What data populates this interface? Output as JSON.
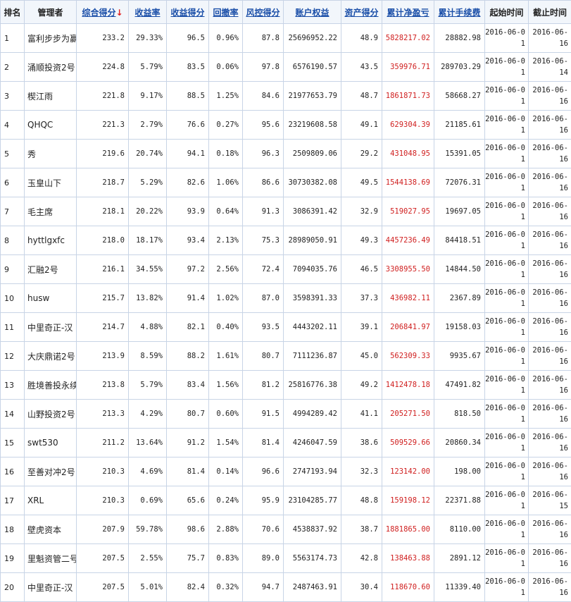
{
  "headers": {
    "rank": "排名",
    "manager": "管理者",
    "score": "综合得分",
    "sort_arrow": "↓",
    "return_rate": "收益率",
    "return_score": "收益得分",
    "drawdown": "回撤率",
    "risk_score": "风控得分",
    "equity": "账户权益",
    "asset_score": "资产得分",
    "cum_pnl": "累计净盈亏",
    "cum_fee": "累计手续费",
    "start_time": "起始时间",
    "end_time": "截止时间"
  },
  "colors": {
    "link": "#1a4ea8",
    "profit": "#d02020",
    "border": "#c8d4e6",
    "arrow": "#e02020"
  },
  "rows": [
    {
      "rank": "1",
      "manager": "富利步步为赢",
      "score": "233.2",
      "return_rate": "29.33%",
      "return_score": "96.5",
      "drawdown": "0.96%",
      "risk_score": "87.8",
      "equity": "25696952.22",
      "asset_score": "48.9",
      "cum_pnl": "5828217.02",
      "cum_fee": "28882.98",
      "start": "2016-06-01",
      "end": "2016-06-16"
    },
    {
      "rank": "2",
      "manager": "涌顺投资2号",
      "score": "224.8",
      "return_rate": "5.79%",
      "return_score": "83.5",
      "drawdown": "0.06%",
      "risk_score": "97.8",
      "equity": "6576190.57",
      "asset_score": "43.5",
      "cum_pnl": "359976.71",
      "cum_fee": "289703.29",
      "start": "2016-06-01",
      "end": "2016-06-14"
    },
    {
      "rank": "3",
      "manager": "楔江雨",
      "score": "221.8",
      "return_rate": "9.17%",
      "return_score": "88.5",
      "drawdown": "1.25%",
      "risk_score": "84.6",
      "equity": "21977653.79",
      "asset_score": "48.7",
      "cum_pnl": "1861871.73",
      "cum_fee": "58668.27",
      "start": "2016-06-01",
      "end": "2016-06-16"
    },
    {
      "rank": "4",
      "manager": "QHQC",
      "score": "221.3",
      "return_rate": "2.79%",
      "return_score": "76.6",
      "drawdown": "0.27%",
      "risk_score": "95.6",
      "equity": "23219608.58",
      "asset_score": "49.1",
      "cum_pnl": "629304.39",
      "cum_fee": "21185.61",
      "start": "2016-06-01",
      "end": "2016-06-16"
    },
    {
      "rank": "5",
      "manager": "秀",
      "score": "219.6",
      "return_rate": "20.74%",
      "return_score": "94.1",
      "drawdown": "0.18%",
      "risk_score": "96.3",
      "equity": "2509809.06",
      "asset_score": "29.2",
      "cum_pnl": "431048.95",
      "cum_fee": "15391.05",
      "start": "2016-06-01",
      "end": "2016-06-16"
    },
    {
      "rank": "6",
      "manager": "玉皇山下",
      "score": "218.7",
      "return_rate": "5.29%",
      "return_score": "82.6",
      "drawdown": "1.06%",
      "risk_score": "86.6",
      "equity": "30730382.08",
      "asset_score": "49.5",
      "cum_pnl": "1544138.69",
      "cum_fee": "72076.31",
      "start": "2016-06-01",
      "end": "2016-06-16"
    },
    {
      "rank": "7",
      "manager": "毛主席",
      "score": "218.1",
      "return_rate": "20.22%",
      "return_score": "93.9",
      "drawdown": "0.64%",
      "risk_score": "91.3",
      "equity": "3086391.42",
      "asset_score": "32.9",
      "cum_pnl": "519027.95",
      "cum_fee": "19697.05",
      "start": "2016-06-01",
      "end": "2016-06-16"
    },
    {
      "rank": "8",
      "manager": "hyttlgxfc",
      "score": "218.0",
      "return_rate": "18.17%",
      "return_score": "93.4",
      "drawdown": "2.13%",
      "risk_score": "75.3",
      "equity": "28989050.91",
      "asset_score": "49.3",
      "cum_pnl": "4457236.49",
      "cum_fee": "84418.51",
      "start": "2016-06-01",
      "end": "2016-06-16"
    },
    {
      "rank": "9",
      "manager": "汇融2号",
      "score": "216.1",
      "return_rate": "34.55%",
      "return_score": "97.2",
      "drawdown": "2.56%",
      "risk_score": "72.4",
      "equity": "7094035.76",
      "asset_score": "46.5",
      "cum_pnl": "3308955.50",
      "cum_fee": "14844.50",
      "start": "2016-06-01",
      "end": "2016-06-16"
    },
    {
      "rank": "10",
      "manager": "husw",
      "score": "215.7",
      "return_rate": "13.82%",
      "return_score": "91.4",
      "drawdown": "1.02%",
      "risk_score": "87.0",
      "equity": "3598391.33",
      "asset_score": "37.3",
      "cum_pnl": "436982.11",
      "cum_fee": "2367.89",
      "start": "2016-06-01",
      "end": "2016-06-16"
    },
    {
      "rank": "11",
      "manager": "中里奇正-汉",
      "score": "214.7",
      "return_rate": "4.88%",
      "return_score": "82.1",
      "drawdown": "0.40%",
      "risk_score": "93.5",
      "equity": "4443202.11",
      "asset_score": "39.1",
      "cum_pnl": "206841.97",
      "cum_fee": "19158.03",
      "start": "2016-06-01",
      "end": "2016-06-16"
    },
    {
      "rank": "12",
      "manager": "大庆鼎诺2号",
      "score": "213.9",
      "return_rate": "8.59%",
      "return_score": "88.2",
      "drawdown": "1.61%",
      "risk_score": "80.7",
      "equity": "7111236.87",
      "asset_score": "45.0",
      "cum_pnl": "562309.33",
      "cum_fee": "9935.67",
      "start": "2016-06-01",
      "end": "2016-06-16"
    },
    {
      "rank": "13",
      "manager": "胜境善投永续",
      "score": "213.8",
      "return_rate": "5.79%",
      "return_score": "83.4",
      "drawdown": "1.56%",
      "risk_score": "81.2",
      "equity": "25816776.38",
      "asset_score": "49.2",
      "cum_pnl": "1412478.18",
      "cum_fee": "47491.82",
      "start": "2016-06-01",
      "end": "2016-06-16"
    },
    {
      "rank": "14",
      "manager": "山野投资2号",
      "score": "213.3",
      "return_rate": "4.29%",
      "return_score": "80.7",
      "drawdown": "0.60%",
      "risk_score": "91.5",
      "equity": "4994289.42",
      "asset_score": "41.1",
      "cum_pnl": "205271.50",
      "cum_fee": "818.50",
      "start": "2016-06-01",
      "end": "2016-06-16"
    },
    {
      "rank": "15",
      "manager": "swt530",
      "score": "211.2",
      "return_rate": "13.64%",
      "return_score": "91.2",
      "drawdown": "1.54%",
      "risk_score": "81.4",
      "equity": "4246047.59",
      "asset_score": "38.6",
      "cum_pnl": "509529.66",
      "cum_fee": "20860.34",
      "start": "2016-06-01",
      "end": "2016-06-16"
    },
    {
      "rank": "16",
      "manager": "至善对冲2号",
      "score": "210.3",
      "return_rate": "4.69%",
      "return_score": "81.4",
      "drawdown": "0.14%",
      "risk_score": "96.6",
      "equity": "2747193.94",
      "asset_score": "32.3",
      "cum_pnl": "123142.00",
      "cum_fee": "198.00",
      "start": "2016-06-01",
      "end": "2016-06-16"
    },
    {
      "rank": "17",
      "manager": "XRL",
      "score": "210.3",
      "return_rate": "0.69%",
      "return_score": "65.6",
      "drawdown": "0.24%",
      "risk_score": "95.9",
      "equity": "23104285.77",
      "asset_score": "48.8",
      "cum_pnl": "159198.12",
      "cum_fee": "22371.88",
      "start": "2016-06-01",
      "end": "2016-06-15"
    },
    {
      "rank": "18",
      "manager": "壁虎资本",
      "score": "207.9",
      "return_rate": "59.78%",
      "return_score": "98.6",
      "drawdown": "2.88%",
      "risk_score": "70.6",
      "equity": "4538837.92",
      "asset_score": "38.7",
      "cum_pnl": "1881865.00",
      "cum_fee": "8110.00",
      "start": "2016-06-01",
      "end": "2016-06-16"
    },
    {
      "rank": "19",
      "manager": "里魁资管二号",
      "score": "207.5",
      "return_rate": "2.55%",
      "return_score": "75.7",
      "drawdown": "0.83%",
      "risk_score": "89.0",
      "equity": "5563174.73",
      "asset_score": "42.8",
      "cum_pnl": "138463.88",
      "cum_fee": "2891.12",
      "start": "2016-06-01",
      "end": "2016-06-16"
    },
    {
      "rank": "20",
      "manager": "中里奇正-汉",
      "score": "207.5",
      "return_rate": "5.01%",
      "return_score": "82.4",
      "drawdown": "0.32%",
      "risk_score": "94.7",
      "equity": "2487463.91",
      "asset_score": "30.4",
      "cum_pnl": "118670.60",
      "cum_fee": "11339.40",
      "start": "2016-06-01",
      "end": "2016-06-16"
    }
  ]
}
